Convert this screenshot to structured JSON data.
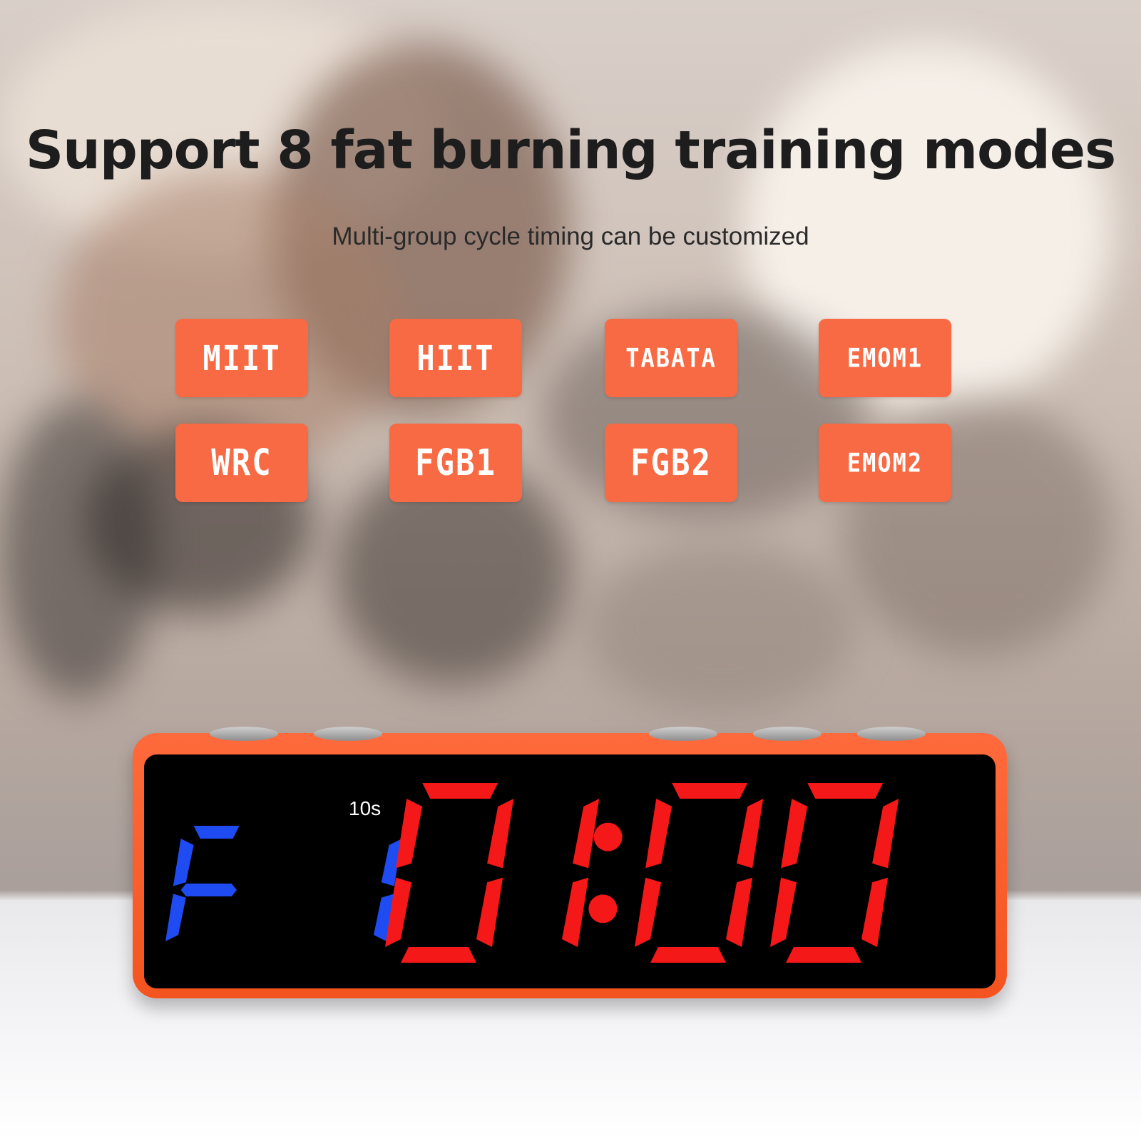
{
  "title": "Support 8 fat burning training modes",
  "subtitle": "Multi-group cycle timing can be customized",
  "modes": [
    {
      "label": "MIIT"
    },
    {
      "label": "HIIT"
    },
    {
      "label": "TABATA"
    },
    {
      "label": "EMOM1"
    },
    {
      "label": "WRC"
    },
    {
      "label": "FGB1"
    },
    {
      "label": "FGB2"
    },
    {
      "label": "EMOM2"
    }
  ],
  "device": {
    "interval_label": "10s",
    "mode_readout": "F1",
    "time_readout": "0 1:00",
    "colors": {
      "body": "#f4541f",
      "mode_digits": "#1f4cf2",
      "time_digits": "#f51818",
      "mode_badge": "#f86a43"
    }
  }
}
